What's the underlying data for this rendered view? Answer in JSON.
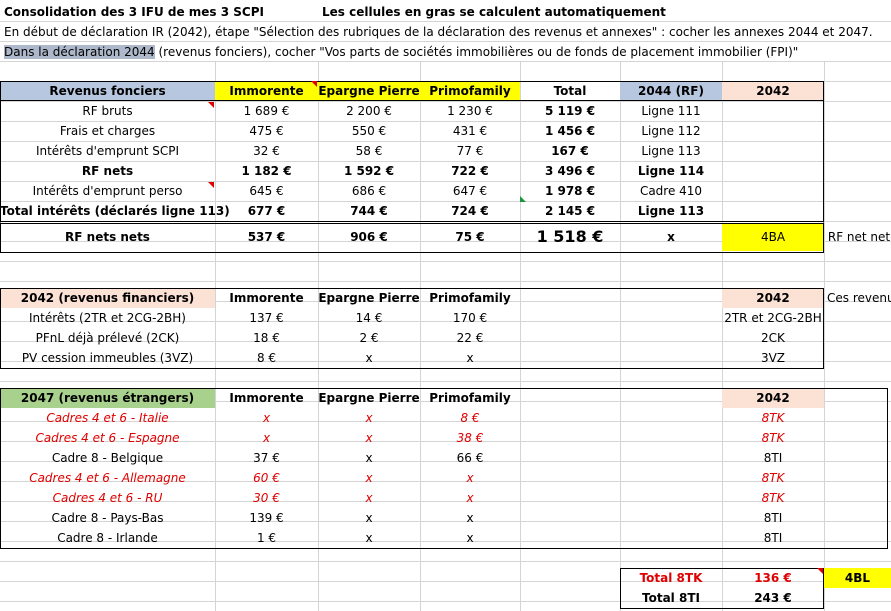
{
  "title": "Consolidation des 3 IFU de mes 3 SCPI",
  "title_note": "Les cellules en gras se calculent automatiquement",
  "instruction1": "En début de déclaration IR (2042), étape \"Sélection des rubriques de la déclaration des revenus et annexes\" : cocher les annexes 2044 et 2047.",
  "instruction2_prefix": "Dans la déclaration 2044",
  "instruction2_rest": " (revenus fonciers), cocher \"Vos parts de sociétés immobilières ou de fonds de placement immobilier (FPI)\"",
  "colors": {
    "blue_header": "#b8c7e0",
    "yellow": "#ffff00",
    "peach": "#fbe2d5",
    "green": "#a9d18e",
    "red_text": "#e00000"
  },
  "rf": {
    "headers": [
      "Revenus fonciers",
      "Immorente",
      "Epargne Pierre",
      "Primofamily",
      "Total",
      "2044 (RF)",
      "2042"
    ],
    "rows": [
      {
        "label": "RF bruts",
        "v": [
          "1 689 €",
          "2 200 €",
          "1 230 €"
        ],
        "total": "5 119 €",
        "ref": "Ligne 111",
        "bold": false
      },
      {
        "label": "Frais et charges",
        "v": [
          "475 €",
          "550 €",
          "431 €"
        ],
        "total": "1 456 €",
        "ref": "Ligne 112",
        "bold": false
      },
      {
        "label": "Intérêts d'emprunt SCPI",
        "v": [
          "32 €",
          "58 €",
          "77 €"
        ],
        "total": "167 €",
        "ref": "Ligne 113",
        "bold": false
      },
      {
        "label": "RF nets",
        "v": [
          "1 182 €",
          "1 592 €",
          "722 €"
        ],
        "total": "3 496 €",
        "ref": "Ligne 114",
        "bold": true
      },
      {
        "label": "Intérêts d'emprunt perso",
        "v": [
          "645 €",
          "686 €",
          "647 €"
        ],
        "total": "1 978 €",
        "ref": "Cadre 410",
        "bold": false
      },
      {
        "label": "Total intérêts (déclarés ligne 113)",
        "v": [
          "677 €",
          "744 €",
          "724 €"
        ],
        "total": "2 145 €",
        "ref": "Ligne 113",
        "bold": true
      }
    ],
    "net": {
      "label": "RF nets nets",
      "v": [
        "537 €",
        "906 €",
        "75 €"
      ],
      "total": "1 518 €",
      "x": "x",
      "code": "4BA",
      "note": "RF net net"
    }
  },
  "fin": {
    "headers": [
      "2042 (revenus financiers)",
      "Immorente",
      "Epargne Pierre",
      "Primofamily",
      "2042"
    ],
    "note": "Ces revenu",
    "rows": [
      {
        "label": "Intérêts (2TR et 2CG-2BH)",
        "v": [
          "137 €",
          "14 €",
          "170 €"
        ],
        "code": "2TR et 2CG-2BH"
      },
      {
        "label": "PFnL déjà prélevé (2CK)",
        "v": [
          "18 €",
          "2 €",
          "22 €"
        ],
        "code": "2CK"
      },
      {
        "label": "PV cession immeubles (3VZ)",
        "v": [
          "8 €",
          "x",
          "x"
        ],
        "code": "3VZ"
      }
    ]
  },
  "etr": {
    "headers": [
      "2047 (revenus étrangers)",
      "Immorente",
      "Epargne Pierre",
      "Primofamily",
      "2042"
    ],
    "rows": [
      {
        "label": "Cadres 4 et 6 - Italie",
        "v": [
          "x",
          "x",
          "8 €"
        ],
        "code": "8TK",
        "red": true
      },
      {
        "label": "Cadres 4 et 6 - Espagne",
        "v": [
          "x",
          "x",
          "38 €"
        ],
        "code": "8TK",
        "red": true
      },
      {
        "label": "Cadre 8 - Belgique",
        "v": [
          "37 €",
          "x",
          "66 €"
        ],
        "code": "8TI",
        "red": false
      },
      {
        "label": "Cadres 4 et 6 - Allemagne",
        "v": [
          "60 €",
          "x",
          "x"
        ],
        "code": "8TK",
        "red": true
      },
      {
        "label": "Cadres 4 et 6 - RU",
        "v": [
          "30 €",
          "x",
          "x"
        ],
        "code": "8TK",
        "red": true
      },
      {
        "label": "Cadre 8 - Pays-Bas",
        "v": [
          "139 €",
          "x",
          "x"
        ],
        "code": "8TI",
        "red": false
      },
      {
        "label": "Cadre 8 - Irlande",
        "v": [
          "1 €",
          "x",
          "x"
        ],
        "code": "8TI",
        "red": false
      }
    ],
    "total_8tk_label": "Total 8TK",
    "total_8tk": "136 €",
    "code_4bl": "4BL",
    "total_8ti_label": "Total 8TI",
    "total_8ti": "243 €"
  }
}
